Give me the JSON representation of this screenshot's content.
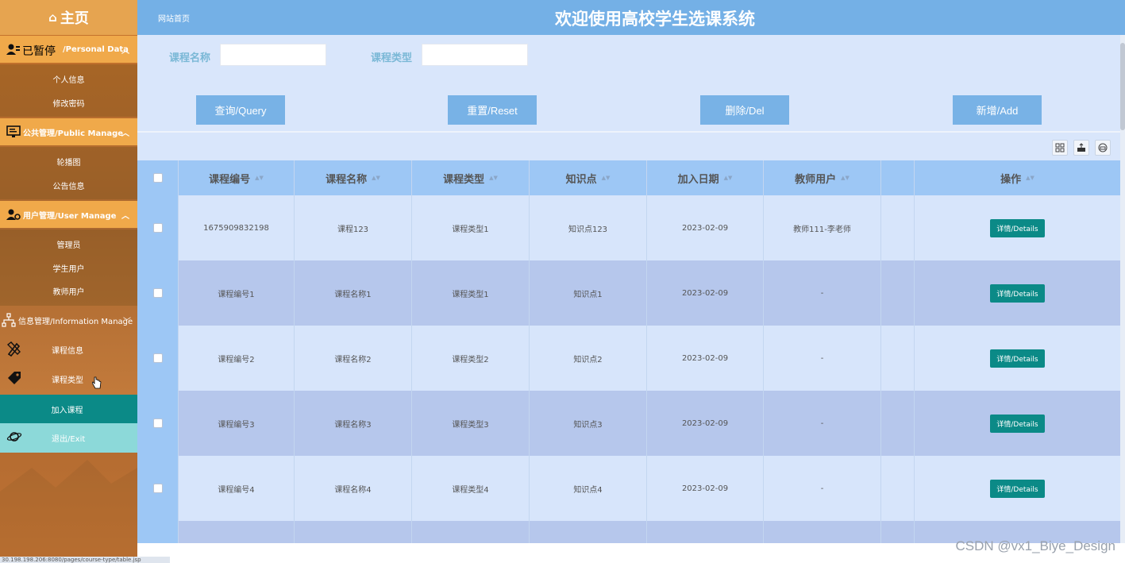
{
  "sidebar": {
    "home_label": "主页",
    "overlay_text": "已暂停",
    "groups": [
      {
        "label": "/Personal Data",
        "icon": "user-card-icon",
        "items": [
          {
            "label": "个人信息"
          },
          {
            "label": "修改密码"
          }
        ]
      },
      {
        "label": "公共管理/Public Manage",
        "icon": "monitor-icon",
        "items": [
          {
            "label": "轮播图"
          },
          {
            "label": "公告信息"
          }
        ]
      },
      {
        "label": "用户管理/User Manage",
        "icon": "user-gear-icon",
        "items": [
          {
            "label": "管理员"
          },
          {
            "label": "学生用户"
          },
          {
            "label": "教师用户"
          }
        ]
      },
      {
        "label": "信息管理/Information Manage",
        "icon": "sitemap-icon",
        "items": [
          {
            "label": "课程信息",
            "icon": "pencil-ruler-icon"
          },
          {
            "label": "课程类型",
            "icon": "tag-icon"
          },
          {
            "label": "加入课程"
          },
          {
            "label": "退出/Exit",
            "icon": "planet-icon"
          }
        ]
      }
    ]
  },
  "header": {
    "breadcrumb": "网站首页",
    "title": "欢迎使用高校学生选课系统"
  },
  "search": {
    "name_label": "课程名称",
    "type_label": "课程类型",
    "name_value": "",
    "type_value": ""
  },
  "buttons": {
    "query": "查询/Query",
    "reset": "重置/Reset",
    "delete": "删除/Del",
    "add": "新增/Add"
  },
  "table": {
    "columns": [
      "课程编号",
      "课程名称",
      "课程类型",
      "知识点",
      "加入日期",
      "教师用户",
      "",
      "操作"
    ],
    "details_label": "详情/Details",
    "rows": [
      [
        "1675909832198",
        "课程123",
        "课程类型1",
        "知识点123",
        "2023-02-09",
        "教师111-李老师"
      ],
      [
        "课程编号1",
        "课程名称1",
        "课程类型1",
        "知识点1",
        "2023-02-09",
        "-"
      ],
      [
        "课程编号2",
        "课程名称2",
        "课程类型2",
        "知识点2",
        "2023-02-09",
        "-"
      ],
      [
        "课程编号3",
        "课程名称3",
        "课程类型3",
        "知识点3",
        "2023-02-09",
        "-"
      ],
      [
        "课程编号4",
        "课程名称4",
        "课程类型4",
        "知识点4",
        "2023-02-09",
        "-"
      ]
    ]
  },
  "watermark": "CSDN @vx1_Biye_Design",
  "status_url": "30.198.198.206:8080/pages/course-type/table.jsp",
  "colors": {
    "sidebar_header": "#f0a94a",
    "active_item": "#0b8a87",
    "topbar": "#74b0e6",
    "button": "#78b2e6"
  }
}
